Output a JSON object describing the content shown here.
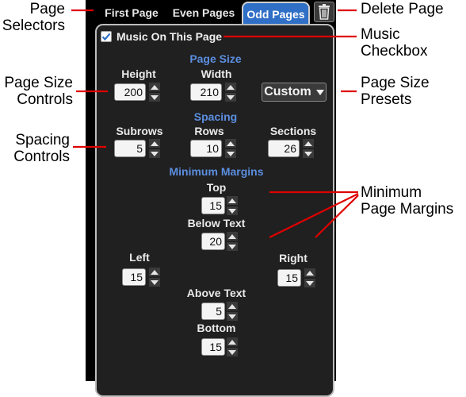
{
  "tabs": [
    {
      "label": "First Page",
      "active": false
    },
    {
      "label": "Even Pages",
      "active": false
    },
    {
      "label": "Odd Pages",
      "active": true
    }
  ],
  "icons": {
    "delete": "trash-icon",
    "checkbox": "checkmark-icon",
    "spinner_up": "triangle-up-icon",
    "spinner_down": "triangle-down-icon",
    "dropdown": "triangle-down-icon"
  },
  "music_checkbox": {
    "label": "Music On This Page",
    "checked": true
  },
  "page_size": {
    "heading": "Page Size",
    "height": {
      "label": "Height",
      "value": "200"
    },
    "width": {
      "label": "Width",
      "value": "210"
    },
    "preset": "Custom"
  },
  "spacing": {
    "heading": "Spacing",
    "subrows": {
      "label": "Subrows",
      "value": "5"
    },
    "rows": {
      "label": "Rows",
      "value": "10"
    },
    "sections": {
      "label": "Sections",
      "value": "26"
    }
  },
  "margins": {
    "heading": "Minimum Margins",
    "top": {
      "label": "Top",
      "value": "15"
    },
    "below_text": {
      "label": "Below Text",
      "value": "20"
    },
    "left": {
      "label": "Left",
      "value": "15"
    },
    "right": {
      "label": "Right",
      "value": "15"
    },
    "above_text": {
      "label": "Above Text",
      "value": "5"
    },
    "bottom": {
      "label": "Bottom",
      "value": "15"
    }
  },
  "callouts": {
    "page_selectors": "Page Selectors",
    "page_size_controls": "Page Size Controls",
    "spacing_controls": "Spacing Controls",
    "delete_page": "Delete Page",
    "music_checkbox": "Music Checkbox",
    "page_size_presets": "Page Size Presets",
    "minimum_page_margins": "Minimum Page Margins"
  },
  "colors": {
    "accent_blue": "#2f6fc6",
    "heading_blue": "#5b8ee0",
    "callout_line": "#e00000",
    "panel_bg": "#202020"
  }
}
